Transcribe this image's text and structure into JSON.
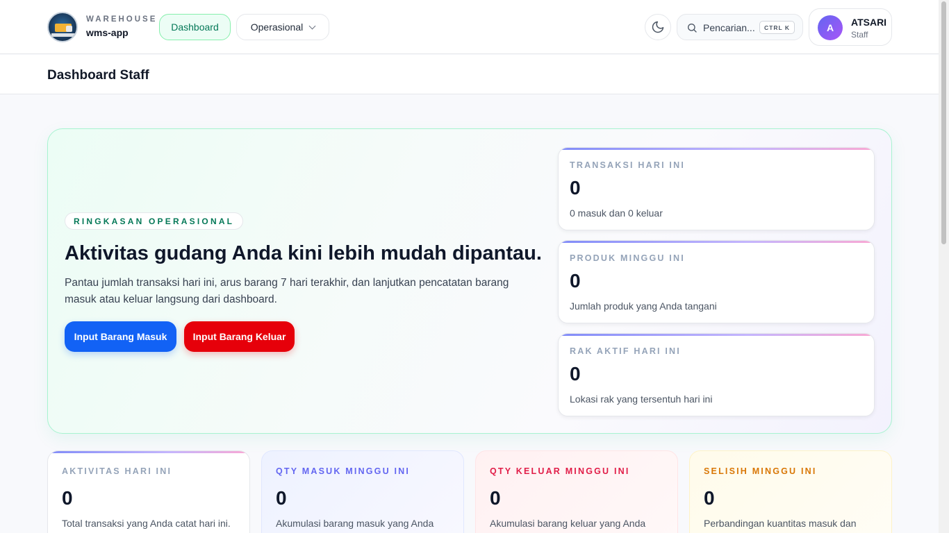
{
  "brand": {
    "kicker": "WAREHOUSE",
    "name": "wms-app"
  },
  "nav": {
    "dashboard": "Dashboard",
    "operational": "Operasional"
  },
  "search": {
    "placeholder": "Pencarian...",
    "shortcut": "CTRL K"
  },
  "user": {
    "initial": "A",
    "name": "ATSARI",
    "role": "Staff"
  },
  "page": {
    "title": "Dashboard Staff"
  },
  "hero": {
    "pill": "RINGKASAN OPERASIONAL",
    "title": "Aktivitas gudang Anda kini lebih mudah dipantau.",
    "description": "Pantau jumlah transaksi hari ini, arus barang 7 hari terakhir, dan lanjutkan pencatatan barang masuk atau keluar langsung dari dashboard.",
    "btn_in": "Input Barang Masuk",
    "btn_out": "Input Barang Keluar",
    "colors": {
      "in": "#1262f5",
      "out": "#e6000a",
      "accent": "#047857"
    }
  },
  "stats": [
    {
      "label": "TRANSAKSI HARI INI",
      "value": "0",
      "sub": "0 masuk dan 0 keluar"
    },
    {
      "label": "PRODUK MINGGU INI",
      "value": "0",
      "sub": "Jumlah produk yang Anda tangani"
    },
    {
      "label": "RAK AKTIF HARI INI",
      "value": "0",
      "sub": "Lokasi rak yang tersentuh hari ini"
    }
  ],
  "cards": [
    {
      "label": "AKTIVITAS HARI INI",
      "value": "0",
      "sub": "Total transaksi yang Anda catat hari ini."
    },
    {
      "label": "QTY MASUK MINGGU INI",
      "value": "0",
      "sub": "Akumulasi barang masuk yang Anda"
    },
    {
      "label": "QTY KELUAR MINGGU INI",
      "value": "0",
      "sub": "Akumulasi barang keluar yang Anda"
    },
    {
      "label": "SELISIH MINGGU INI",
      "value": "0",
      "sub": "Perbandingan kuantitas masuk dan"
    }
  ],
  "icons": {
    "logo": "warehouse-logo",
    "theme": "moon-icon",
    "search": "search-icon",
    "chevron": "chevron-down-icon"
  }
}
